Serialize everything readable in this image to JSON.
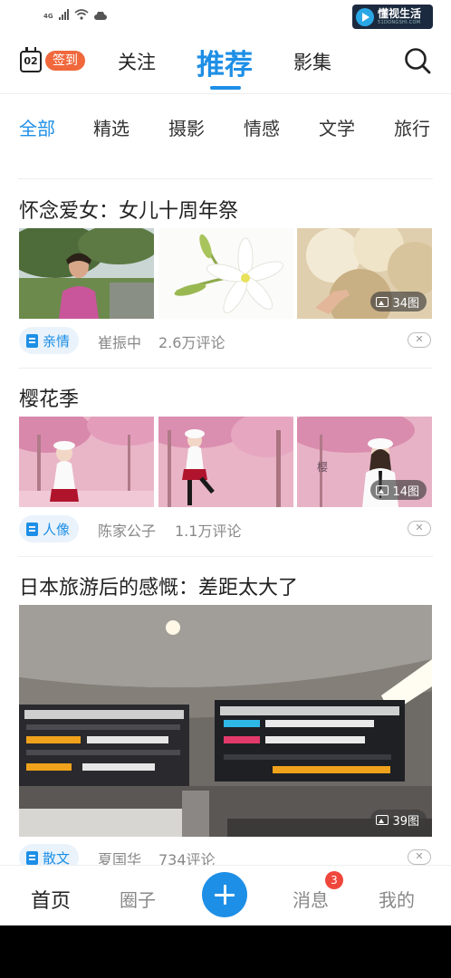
{
  "status_bar": {
    "network": "4G",
    "watermark": {
      "title": "懂视生活",
      "subtitle": "51DONGSHI.COM"
    }
  },
  "header": {
    "calendar_day": "02",
    "signin_label": "签到",
    "tabs": [
      {
        "label": "关注"
      },
      {
        "label": "推荐",
        "active": true
      },
      {
        "label": "影集"
      }
    ],
    "search_icon": "search-icon"
  },
  "categories": [
    {
      "label": "全部",
      "active": true
    },
    {
      "label": "精选"
    },
    {
      "label": "摄影"
    },
    {
      "label": "情感"
    },
    {
      "label": "文学"
    },
    {
      "label": "旅行"
    }
  ],
  "articles": [
    {
      "title": "怀念爱女：女儿十周年祭",
      "photo_count": "34图",
      "tag": "亲情",
      "author": "崔振中",
      "comments": "2.6万评论"
    },
    {
      "title": "樱花季",
      "photo_count": "14图",
      "tag": "人像",
      "author": "陈家公子",
      "comments": "1.1万评论"
    },
    {
      "title": "日本旅游后的感慨：差距太大了",
      "photo_count": "39图",
      "tag": "散文",
      "author": "夏国华",
      "comments": "734评论"
    }
  ],
  "bottom_nav": {
    "items": [
      {
        "label": "首页",
        "active": true
      },
      {
        "label": "圈子"
      },
      {
        "label": "消息",
        "badge": "3"
      },
      {
        "label": "我的"
      }
    ],
    "plus_icon": "plus-icon"
  },
  "colors": {
    "accent": "#1e8fe6",
    "signin": "#f0683c",
    "badge": "#f0473c"
  }
}
